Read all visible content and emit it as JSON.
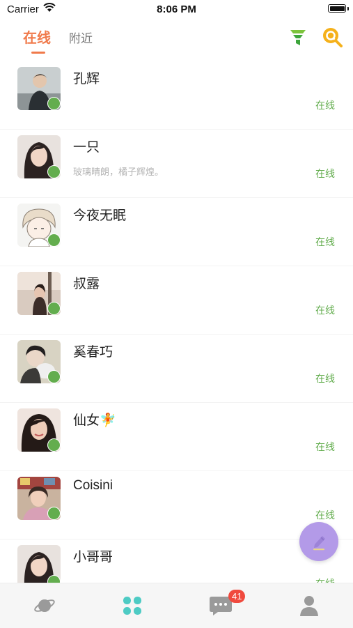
{
  "status_bar": {
    "carrier": "Carrier",
    "time": "8:06 PM"
  },
  "tabs": {
    "online": "在线",
    "nearby": "附近"
  },
  "users": [
    {
      "name": "孔辉",
      "signature": "",
      "status": "在线"
    },
    {
      "name": "一只",
      "signature": "玻璃晴朗，橘子辉煌。",
      "status": "在线"
    },
    {
      "name": "今夜无眠",
      "signature": "",
      "status": "在线"
    },
    {
      "name": "叔露",
      "signature": "",
      "status": "在线"
    },
    {
      "name": "奚春巧",
      "signature": "",
      "status": "在线"
    },
    {
      "name": "仙女🧚",
      "signature": "",
      "status": "在线"
    },
    {
      "name": "Coisini",
      "signature": "",
      "status": "在线"
    },
    {
      "name": "小哥哥",
      "signature": "",
      "status": "在线"
    }
  ],
  "tabbar": {
    "messages_badge": "41"
  },
  "colors": {
    "accent": "#f07a4b",
    "online": "#63ad4e",
    "fab": "#b39ae8",
    "teal": "#4ecbc4",
    "badge": "#f04a3e"
  },
  "icons": {
    "filter": "filter-icon",
    "search": "search-icon",
    "compose": "pencil-icon",
    "discover": "planet-icon",
    "home": "grid-icon",
    "messages": "chat-icon",
    "profile": "person-icon"
  }
}
